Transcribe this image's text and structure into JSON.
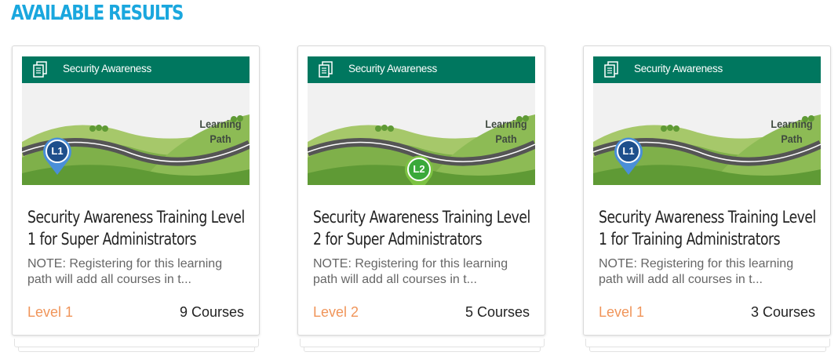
{
  "page": {
    "heading": "AVAILABLE RESULTS"
  },
  "colors": {
    "heading": "#1aa7de",
    "thumb_header": "#00775f",
    "level_text": "#f0955a"
  },
  "cards": [
    {
      "thumb_title": "Security Awareness",
      "badge": "L1",
      "badge_color": "#1e4f8c",
      "thumb_caption_line1": "Learning",
      "thumb_caption_line2": "Path",
      "title": "Security Awareness Training Level 1 for Super Administrators",
      "note": "NOTE: Registering for this learning path will add all courses in t...",
      "level": "Level 1",
      "courses": "9 Courses"
    },
    {
      "thumb_title": "Security Awareness",
      "badge": "L2",
      "badge_color": "#3aa93a",
      "thumb_caption_line1": "Learning",
      "thumb_caption_line2": "Path",
      "title": "Security Awareness Training Level 2 for Super Administrators",
      "note": "NOTE: Registering for this learning path will add all courses in t...",
      "level": "Level 2",
      "courses": "5 Courses"
    },
    {
      "thumb_title": "Security Awareness",
      "badge": "L1",
      "badge_color": "#1e4f8c",
      "thumb_caption_line1": "Learning",
      "thumb_caption_line2": "Path",
      "title": "Security Awareness Training Level 1 for Training Administrators",
      "note": "NOTE: Registering for this learning path will add all courses in t...",
      "level": "Level 1",
      "courses": "3 Courses"
    }
  ]
}
